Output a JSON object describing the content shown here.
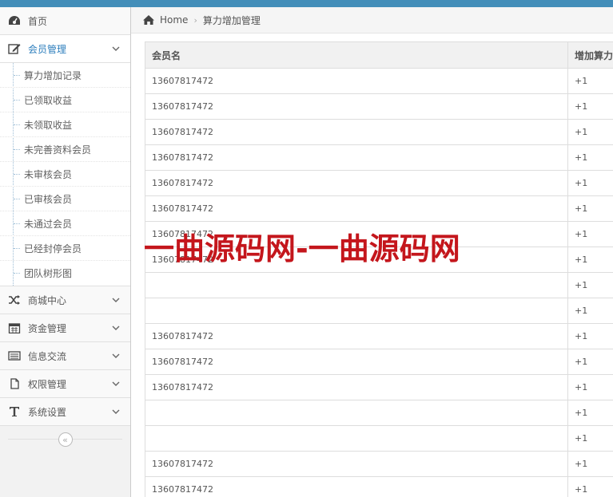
{
  "sidebar": {
    "home": {
      "label": "首页",
      "icon": "dashboard-icon"
    },
    "member": {
      "label": "会员管理",
      "icon": "edit-icon"
    },
    "member_items": [
      {
        "label": "算力增加记录"
      },
      {
        "label": "已领取收益"
      },
      {
        "label": "未领取收益"
      },
      {
        "label": "未完善资料会员"
      },
      {
        "label": "未审核会员"
      },
      {
        "label": "已审核会员"
      },
      {
        "label": "未通过会员"
      },
      {
        "label": "已经封停会员"
      },
      {
        "label": "团队树形图"
      }
    ],
    "menus": [
      {
        "label": "商城中心",
        "icon": "shuffle-icon"
      },
      {
        "label": "资金管理",
        "icon": "calendar-icon"
      },
      {
        "label": "信息交流",
        "icon": "list-icon"
      },
      {
        "label": "权限管理",
        "icon": "file-icon"
      },
      {
        "label": "系统设置",
        "icon": "text-icon"
      }
    ],
    "collapse_glyph": "«"
  },
  "breadcrumb": {
    "home": "Home",
    "current": "算力增加管理"
  },
  "table": {
    "headers": [
      "会员名",
      "增加算力"
    ],
    "rows": [
      [
        "13607817472",
        "+1"
      ],
      [
        "13607817472",
        "+1"
      ],
      [
        "13607817472",
        "+1"
      ],
      [
        "13607817472",
        "+1"
      ],
      [
        "13607817472",
        "+1"
      ],
      [
        "13607817472",
        "+1"
      ],
      [
        "13607817472",
        "+1"
      ],
      [
        "13607817472",
        "+1"
      ],
      [
        "",
        "+1"
      ],
      [
        "",
        "+1"
      ],
      [
        "13607817472",
        "+1"
      ],
      [
        "13607817472",
        "+1"
      ],
      [
        "13607817472",
        "+1"
      ],
      [
        "",
        "+1"
      ],
      [
        "",
        "+1"
      ],
      [
        "13607817472",
        "+1"
      ],
      [
        "13607817472",
        "+1"
      ]
    ]
  },
  "watermark": "一曲源码网-一曲源码网",
  "colors": {
    "topbar": "#438eb9",
    "watermark": "#c4161c",
    "active": "#2b7dbc"
  }
}
